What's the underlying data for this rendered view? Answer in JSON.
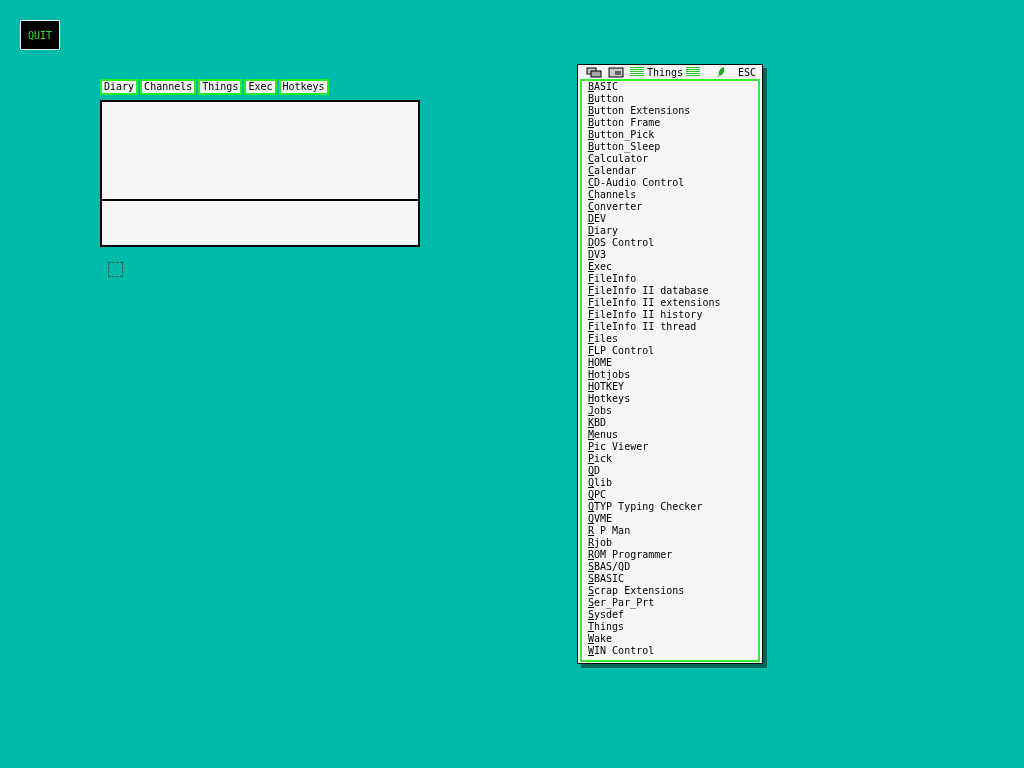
{
  "quit_button": {
    "label": "QUIT"
  },
  "main_window": {
    "tabs": [
      {
        "label": "Diary"
      },
      {
        "label": "Channels"
      },
      {
        "label": "Things"
      },
      {
        "label": "Exec"
      },
      {
        "label": "Hotkeys"
      }
    ]
  },
  "things_window": {
    "title": "Things",
    "esc": "ESC",
    "items": [
      "BASIC",
      "Button",
      "Button Extensions",
      "Button Frame",
      "Button_Pick",
      "Button_Sleep",
      "Calculator",
      "Calendar",
      "CD-Audio Control",
      "Channels",
      "Converter",
      "DEV",
      "Diary",
      "DOS Control",
      "DV3",
      "Exec",
      "FileInfo",
      "FileInfo II database",
      "FileInfo II extensions",
      "FileInfo II history",
      "FileInfo II thread",
      "Files",
      "FLP Control",
      "HOME",
      "Hotjobs",
      "HOTKEY",
      "Hotkeys",
      "Jobs",
      "KBD",
      "Menus",
      "Pic Viewer",
      "Pick",
      "QD",
      "Qlib",
      "QPC",
      "QTYP Typing Checker",
      "QVME",
      "R P Man",
      "Rjob",
      "ROM Programmer",
      "SBAS/QD",
      "SBASIC",
      "Scrap Extensions",
      "Ser_Par_Prt",
      "Sysdef",
      "Things",
      "Wake",
      "WIN Control"
    ]
  }
}
